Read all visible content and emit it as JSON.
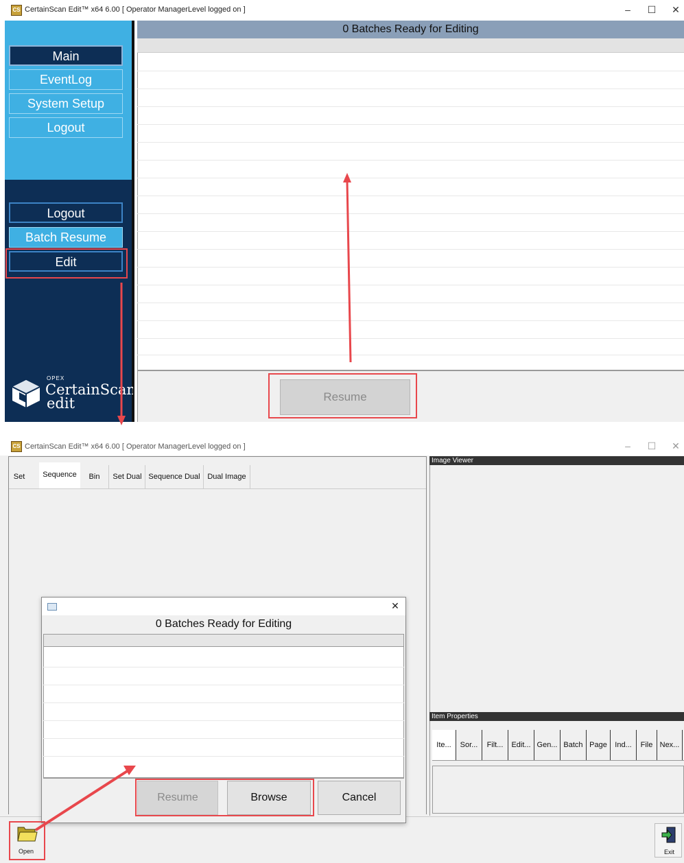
{
  "top": {
    "title": "CertainScan Edit™ x64 6.00  [ Operator ManagerLevel logged on ]",
    "app_icon_text": "CS",
    "header": "0 Batches Ready for Editing",
    "nav_top": [
      "Main",
      "EventLog",
      "System Setup",
      "Logout"
    ],
    "nav_bottom": [
      "Logout",
      "Batch Resume",
      "Edit"
    ],
    "resume_label": "Resume",
    "logo": {
      "brand": "OPEX",
      "name": "CertainScan",
      "sub": "edit"
    }
  },
  "bottom": {
    "title": "CertainScan Edit™ x64 6.00  [ Operator ManagerLevel logged on ]",
    "tabs": [
      "Set",
      "Sequence",
      "Bin",
      "Set Dual",
      "Sequence Dual",
      "Dual Image"
    ],
    "image_viewer": "Image Viewer",
    "item_properties": "Item Properties",
    "prop_tabs": [
      "Ite...",
      "Sor...",
      "Filt...",
      "Edit...",
      "Gen...",
      "Batch",
      "Page",
      "Ind...",
      "File",
      "Nex..."
    ],
    "dialog": {
      "header": "0 Batches Ready for Editing",
      "resume": "Resume",
      "browse": "Browse",
      "cancel": "Cancel"
    },
    "open_label": "Open",
    "exit_label": "Exit"
  },
  "window_controls": {
    "minimize": "–",
    "maximize": "☐",
    "close": "✕"
  },
  "colors": {
    "sidebar_light": "#3fb0e3",
    "sidebar_dark": "#0d2e55",
    "header_bar": "#8a9fb8",
    "annotation_red": "#e8474c"
  }
}
